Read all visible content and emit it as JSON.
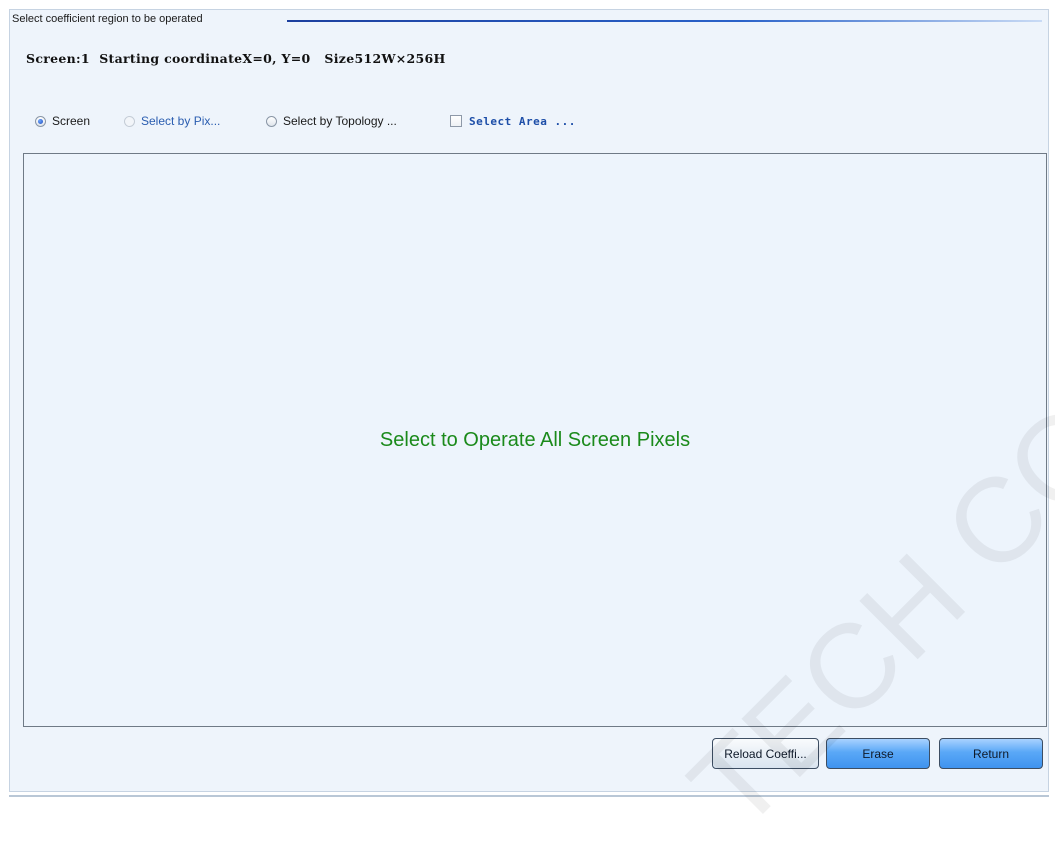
{
  "group": {
    "title": "Select coefficient region to be operated"
  },
  "info": {
    "text": "Screen:1  Starting coordinateX=0, Y=0   Size512W×256H"
  },
  "options": {
    "screen": "Screen",
    "select_by_pixel": "Select by Pix...",
    "select_by_topology": "Select by Topology ...",
    "select_area": "Select Area ..."
  },
  "canvas": {
    "message": "Select to Operate All Screen Pixels"
  },
  "buttons": {
    "reload": "Reload Coeffi...",
    "erase": "Erase",
    "return": "Return"
  },
  "watermark": {
    "text": "TECH CO., LTD"
  },
  "colors": {
    "message_green": "#1b8a1b",
    "link_blue": "#2a5db0",
    "accent_blue": "#3f93ef"
  }
}
